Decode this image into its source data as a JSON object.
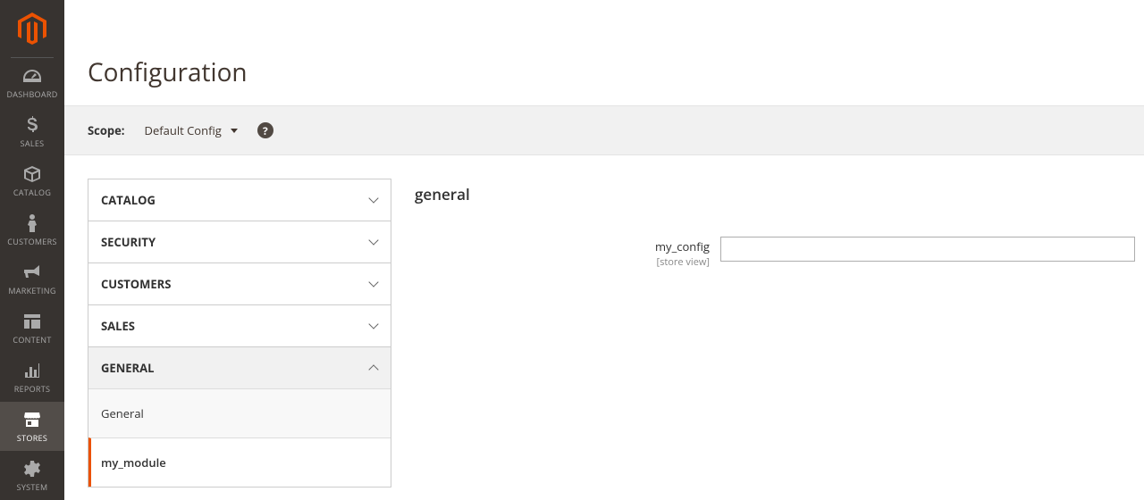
{
  "brand": {
    "accent": "#eb5202"
  },
  "sidebar": {
    "items": [
      {
        "id": "dashboard",
        "label": "DASHBOARD",
        "icon": "dashboard-icon",
        "active": false
      },
      {
        "id": "sales",
        "label": "SALES",
        "icon": "dollar-icon",
        "active": false
      },
      {
        "id": "catalog",
        "label": "CATALOG",
        "icon": "box-icon",
        "active": false
      },
      {
        "id": "customers",
        "label": "CUSTOMERS",
        "icon": "person-icon",
        "active": false
      },
      {
        "id": "marketing",
        "label": "MARKETING",
        "icon": "megaphone-icon",
        "active": false
      },
      {
        "id": "content",
        "label": "CONTENT",
        "icon": "layout-icon",
        "active": false
      },
      {
        "id": "reports",
        "label": "REPORTS",
        "icon": "bars-icon",
        "active": false
      },
      {
        "id": "stores",
        "label": "STORES",
        "icon": "storefront-icon",
        "active": true
      },
      {
        "id": "system",
        "label": "SYSTEM",
        "icon": "gear-icon",
        "active": false
      }
    ]
  },
  "page": {
    "title": "Configuration"
  },
  "scope": {
    "label": "Scope:",
    "value": "Default Config"
  },
  "config_nav": {
    "sections": [
      {
        "id": "catalog",
        "label": "CATALOG",
        "expanded": false,
        "items": []
      },
      {
        "id": "security",
        "label": "SECURITY",
        "expanded": false,
        "items": []
      },
      {
        "id": "customers",
        "label": "CUSTOMERS",
        "expanded": false,
        "items": []
      },
      {
        "id": "sales",
        "label": "SALES",
        "expanded": false,
        "items": []
      },
      {
        "id": "general",
        "label": "GENERAL",
        "expanded": true,
        "items": [
          {
            "label": "General",
            "active": false
          },
          {
            "label": "my_module",
            "active": true
          }
        ]
      }
    ]
  },
  "form": {
    "section_title": "general",
    "fields": [
      {
        "label": "my_config",
        "scope": "[store view]",
        "value": ""
      }
    ]
  }
}
